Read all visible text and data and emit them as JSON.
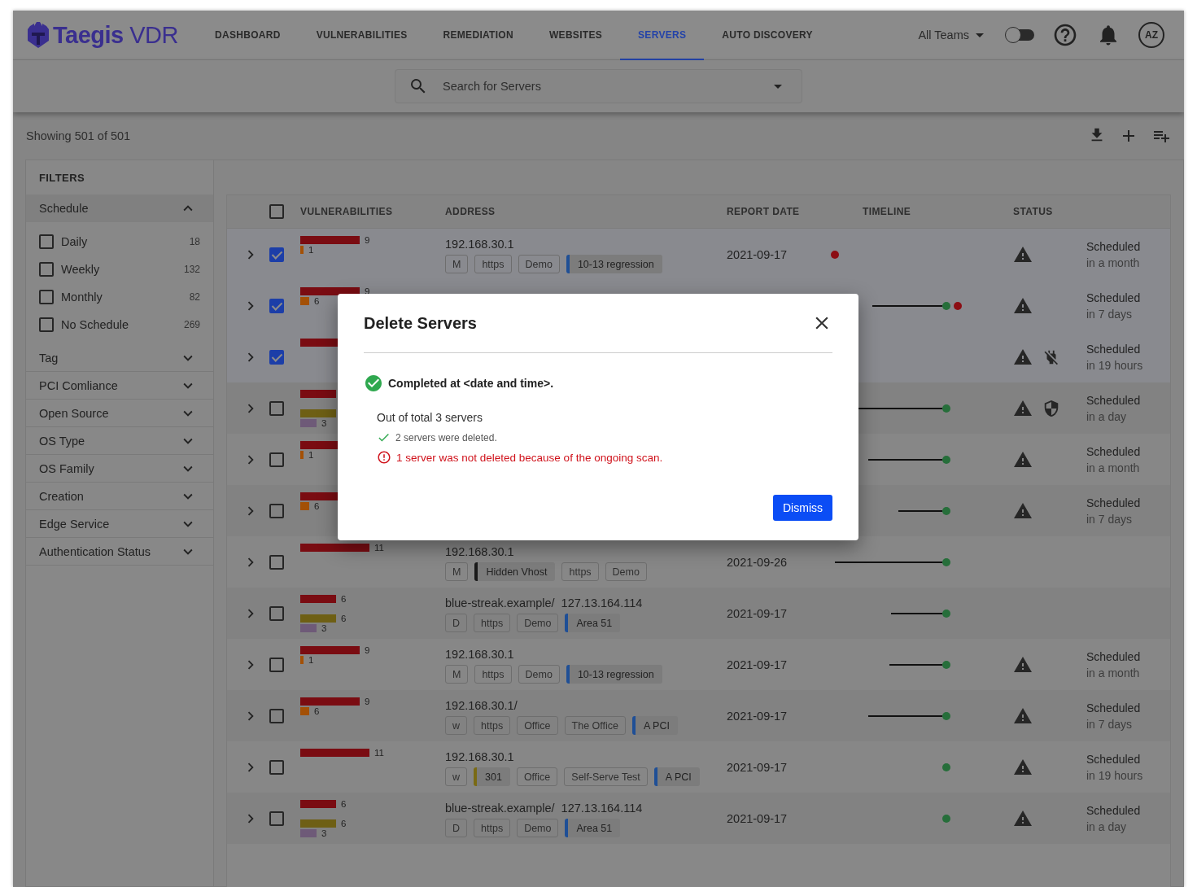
{
  "header": {
    "logo": "**Taegis** VDR",
    "nav": [
      {
        "label": "DASHBOARD",
        "selected": false
      },
      {
        "label": "VULNERABILITIES",
        "selected": false
      },
      {
        "label": "REMEDIATION",
        "selected": false
      },
      {
        "label": "WEBSITES",
        "selected": false
      },
      {
        "label": "SERVERS",
        "selected": true
      },
      {
        "label": "AUTO DISCOVERY",
        "selected": false
      }
    ],
    "team": "All Teams",
    "toggle_on": false,
    "avatar": "AZ"
  },
  "search": {
    "placeholder": "Search for Servers"
  },
  "results": "Showing 501 of 501",
  "filters": {
    "title": "FILTERS",
    "sections": [
      {
        "label": "Schedule",
        "expanded": true,
        "items": [
          {
            "label": "Daily",
            "count": "18",
            "checked": false
          },
          {
            "label": "Weekly",
            "count": "132",
            "checked": false
          },
          {
            "label": "Monthly",
            "count": "82",
            "checked": false
          },
          {
            "label": "No Schedule",
            "count": "269",
            "checked": false
          }
        ]
      },
      {
        "label": "Tag",
        "expanded": false
      },
      {
        "label": "PCI Comliance",
        "expanded": false
      },
      {
        "label": "Open Source",
        "expanded": false
      },
      {
        "label": "OS Type",
        "expanded": false
      },
      {
        "label": "OS Family",
        "expanded": false
      },
      {
        "label": "Creation",
        "expanded": false
      },
      {
        "label": "Edge Service",
        "expanded": false
      },
      {
        "label": "Authentication Status",
        "expanded": false
      }
    ]
  },
  "table": {
    "all_selected": false,
    "columns": [
      "VULNERABILITIES",
      "ADDRESS",
      "REPORT DATE",
      "TIMELINE",
      "STATUS"
    ],
    "rows": [
      {
        "selected": true,
        "vulns": [
          {
            "color": "#7a0c12",
            "level": 0.73,
            "count": "9"
          },
          {
            "color": "#a35006",
            "level": 0.04,
            "count": "1"
          }
        ],
        "address": [
          "192.168.30.1"
        ],
        "tags": [
          {
            "kind": "outline",
            "label": "M"
          },
          {
            "kind": "outline",
            "label": "https"
          },
          {
            "kind": "outline",
            "label": "Demo"
          },
          {
            "kind": "accent",
            "label": "10-13 regression",
            "color": "#1f4f96"
          }
        ],
        "date": "2021-09-17",
        "timeline": {
          "leading": true,
          "level": 0,
          "dots": [
            {
              "color": "#8c0e14"
            }
          ]
        },
        "status": [
          {
            "kind": "warning"
          }
        ],
        "schedule": [
          "Scheduled",
          "in a month"
        ]
      },
      {
        "selected": true,
        "vulns": [
          {
            "color": "#7a0c12",
            "level": 0.73,
            "count": "9"
          },
          {
            "color": "#a35006",
            "level": 0.11,
            "count": "6"
          }
        ],
        "address": [],
        "tags": [],
        "timeline": {
          "leading": false,
          "level": 0.62,
          "dots": [
            {
              "color": "#266e3a"
            },
            {
              "color": "#8c0e14"
            }
          ]
        },
        "status": [
          {
            "kind": "warning"
          }
        ],
        "schedule": [
          "Scheduled",
          "in 7 days"
        ]
      },
      {
        "selected": true,
        "vulns": [
          {
            "color": "#7a0c12",
            "level": 0.73
          }
        ],
        "address": [],
        "tags": [],
        "status": [
          {
            "kind": "warning"
          },
          {
            "kind": "unplugged"
          }
        ],
        "schedule": [
          "Scheduled",
          "in 19 hours"
        ]
      },
      {
        "selected": false,
        "vulns": [
          {
            "color": "#7a0c12",
            "level": 0.44
          },
          {
            "color": "#6e5f14",
            "level": 0.44,
            "kind": "gap"
          },
          {
            "color": "#6e5a78",
            "level": 0.2,
            "count": "3"
          }
        ],
        "address": [],
        "tags": [],
        "timeline": {
          "leading": false,
          "level": 0.75,
          "dots": [
            {
              "color": "#266e3a"
            }
          ]
        },
        "status": [
          {
            "kind": "warning"
          },
          {
            "kind": "shield"
          }
        ],
        "schedule": [
          "Scheduled",
          "in a day"
        ]
      },
      {
        "selected": false,
        "vulns": [
          {
            "color": "#7a0c12",
            "level": 0.73
          },
          {
            "color": "#a35006",
            "level": 0.04,
            "count": "1"
          }
        ],
        "address": [],
        "tags": [],
        "timeline": {
          "leading": false,
          "level": 0.66,
          "dots": [
            {
              "color": "#266e3a"
            }
          ]
        },
        "status": [
          {
            "kind": "warning"
          }
        ],
        "schedule": [
          "Scheduled",
          "in a month"
        ]
      },
      {
        "selected": false,
        "vulns": [
          {
            "color": "#7a0c12",
            "level": 0.73
          },
          {
            "color": "#a35006",
            "level": 0.11,
            "count": "6"
          }
        ],
        "address": [],
        "tags": [],
        "timeline": {
          "leading": false,
          "level": 0.39,
          "dots": [
            {
              "color": "#266e3a"
            }
          ]
        },
        "status": [
          {
            "kind": "warning"
          }
        ],
        "schedule": [
          "Scheduled",
          "in 7 days"
        ]
      },
      {
        "selected": false,
        "vulns": [
          {
            "color": "#7a0c12",
            "level": 0.85,
            "count": "11"
          }
        ],
        "address": [
          "192.168.30.1"
        ],
        "tags": [
          {
            "kind": "outline",
            "label": "M"
          },
          {
            "kind": "accent",
            "label": "Hidden Vhost",
            "color": "#1a1a1a"
          },
          {
            "kind": "outline",
            "label": "https"
          },
          {
            "kind": "outline",
            "label": "Demo"
          }
        ],
        "date": "2021-09-26",
        "timeline": {
          "leading": false,
          "level": 0.96,
          "dots": [
            {
              "color": "#266e3a"
            }
          ]
        },
        "status": [],
        "schedule": []
      },
      {
        "selected": false,
        "vulns": [
          {
            "color": "#7a0c12",
            "level": 0.44,
            "count": "6"
          },
          {
            "color": "#6e5f14",
            "level": 0.44,
            "count": "6",
            "kind": "gap"
          },
          {
            "color": "#6e5a78",
            "level": 0.2,
            "count": "3"
          }
        ],
        "address": [
          "blue-streak.example/",
          "127.13.164.114"
        ],
        "tags": [
          {
            "kind": "outline",
            "label": "D"
          },
          {
            "kind": "outline",
            "label": "https"
          },
          {
            "kind": "outline",
            "label": "Demo"
          },
          {
            "kind": "accent",
            "label": "Area 51",
            "color": "#1f4f96"
          }
        ],
        "date": "2021-09-17",
        "timeline": {
          "leading": false,
          "level": 0.46,
          "dots": [
            {
              "color": "#266e3a"
            }
          ]
        },
        "status": [],
        "schedule": []
      },
      {
        "selected": false,
        "vulns": [
          {
            "color": "#7a0c12",
            "level": 0.73,
            "count": "9"
          },
          {
            "color": "#a35006",
            "level": 0.04,
            "count": "1"
          }
        ],
        "address": [
          "192.168.30.1"
        ],
        "tags": [
          {
            "kind": "outline",
            "label": "M"
          },
          {
            "kind": "outline",
            "label": "https"
          },
          {
            "kind": "outline",
            "label": "Demo"
          },
          {
            "kind": "accent",
            "label": "10-13 regression",
            "color": "#1f4f96"
          }
        ],
        "date": "2021-09-17",
        "timeline": {
          "leading": false,
          "level": 0.47,
          "dots": [
            {
              "color": "#266e3a"
            }
          ]
        },
        "status": [
          {
            "kind": "warning"
          }
        ],
        "schedule": [
          "Scheduled",
          "in a month"
        ]
      },
      {
        "selected": false,
        "vulns": [
          {
            "color": "#7a0c12",
            "level": 0.73,
            "count": "9"
          },
          {
            "color": "#a35006",
            "level": 0.11,
            "count": "6"
          }
        ],
        "address": [
          "192.168.30.1/"
        ],
        "tags": [
          {
            "kind": "outline",
            "label": "w"
          },
          {
            "kind": "outline",
            "label": "https"
          },
          {
            "kind": "outline",
            "label": "Office"
          },
          {
            "kind": "outline",
            "label": "The Office"
          },
          {
            "kind": "accent",
            "label": "A PCI",
            "color": "#1f4f96"
          }
        ],
        "date": "2021-09-17",
        "timeline": {
          "leading": false,
          "level": 0.66,
          "dots": [
            {
              "color": "#266e3a"
            }
          ]
        },
        "status": [
          {
            "kind": "warning"
          }
        ],
        "schedule": [
          "Scheduled",
          "in 7 days"
        ]
      },
      {
        "selected": false,
        "vulns": [
          {
            "color": "#7a0c12",
            "level": 0.85,
            "count": "11"
          }
        ],
        "address": [
          "192.168.30.1"
        ],
        "tags": [
          {
            "kind": "outline",
            "label": "w"
          },
          {
            "kind": "accent",
            "label": "301",
            "color": "#7a6a14"
          },
          {
            "kind": "outline",
            "label": "Office"
          },
          {
            "kind": "outline",
            "label": "Self-Serve Test"
          },
          {
            "kind": "accent",
            "label": "A PCI",
            "color": "#1f4f96"
          }
        ],
        "date": "2021-09-17",
        "timeline": {
          "leading": false,
          "level": 0,
          "dots": [
            {
              "color": "#266e3a"
            }
          ]
        },
        "status": [
          {
            "kind": "warning"
          }
        ],
        "schedule": [
          "Scheduled",
          "in 19 hours"
        ]
      },
      {
        "selected": false,
        "vulns": [
          {
            "color": "#7a0c12",
            "level": 0.44,
            "count": "6"
          },
          {
            "color": "#6e5f14",
            "level": 0.44,
            "count": "6",
            "kind": "gap"
          },
          {
            "color": "#6e5a78",
            "level": 0.2,
            "count": "3"
          }
        ],
        "address": [
          "blue-streak.example/",
          "127.13.164.114"
        ],
        "tags": [
          {
            "kind": "outline",
            "label": "D"
          },
          {
            "kind": "outline",
            "label": "https"
          },
          {
            "kind": "outline",
            "label": "Demo"
          },
          {
            "kind": "accent",
            "label": "Area 51",
            "color": "#1f4f96"
          }
        ],
        "date": "2021-09-17",
        "timeline": {
          "leading": false,
          "level": 0,
          "dots": [
            {
              "color": "#266e3a"
            }
          ]
        },
        "status": [
          {
            "kind": "warning"
          }
        ],
        "schedule": [
          "Scheduled",
          "in a day"
        ]
      }
    ]
  },
  "dialog": {
    "title": "Delete Servers",
    "completed": "Completed at <date and time>.",
    "summary": "Out of total 3 servers",
    "success": "2 servers were deleted.",
    "error": "1 server was not deleted because of the ongoing scan.",
    "button": "Dismiss"
  }
}
